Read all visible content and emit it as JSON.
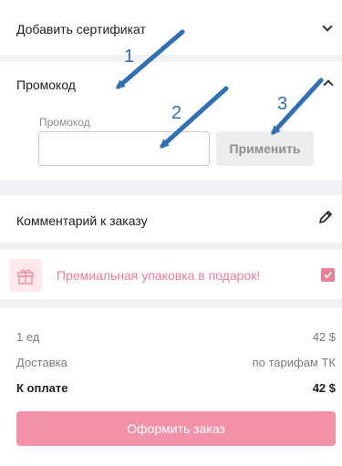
{
  "certificate": {
    "title": "Добавить сертификат",
    "chevron_icon": "chevron-down-icon"
  },
  "promo": {
    "title": "Промокод",
    "chevron_icon": "chevron-up-icon",
    "field_label": "Промокод",
    "field_value": "",
    "apply_label": "Применить"
  },
  "comment": {
    "title": "Комментарий к заказу",
    "icon": "pencil-icon"
  },
  "gift": {
    "text": "Премиальная упаковка в подарок!",
    "checked": true,
    "icon": "gift-icon"
  },
  "summary": {
    "rows": [
      {
        "label": "1 ед",
        "value": "42 $"
      },
      {
        "label": "Доставка",
        "value": "по тарифам ТК"
      }
    ],
    "total": {
      "label": "К оплате",
      "value": "42 $"
    },
    "order_label": "Оформить заказ"
  },
  "annotations": [
    "1",
    "2",
    "3"
  ],
  "colors": {
    "accent": "#f291a7",
    "gift_text": "#ec7e98",
    "annotation": "#2f6fb3",
    "background": "#f1f1f3"
  }
}
